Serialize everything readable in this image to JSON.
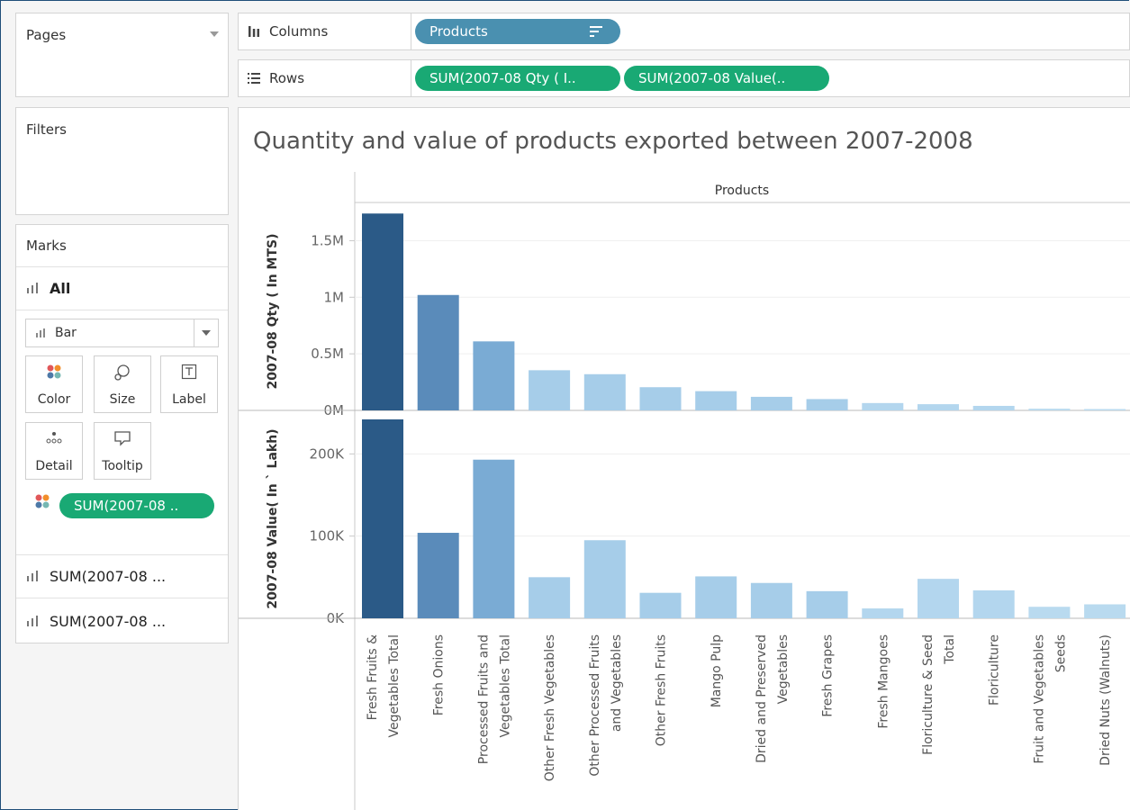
{
  "pages": {
    "title": "Pages"
  },
  "filters": {
    "title": "Filters"
  },
  "marks": {
    "title": "Marks",
    "all_label": "All",
    "mark_type": "Bar",
    "buttons": {
      "color": "Color",
      "size": "Size",
      "label": "Label",
      "detail": "Detail",
      "tooltip": "Tooltip"
    },
    "color_pill": "SUM(2007-08 ..",
    "sub_cards": [
      "SUM(2007-08 ...",
      "SUM(2007-08 ..."
    ]
  },
  "columns": {
    "label": "Columns",
    "pill": "Products"
  },
  "rows": {
    "label": "Rows",
    "pills": [
      "SUM(2007-08 Qty ( I..",
      "SUM(2007-08 Value(.."
    ]
  },
  "view": {
    "title": "Quantity and value of products exported  between 2007-2008",
    "header": "Products"
  },
  "chart_data": {
    "type": "bar",
    "categories": [
      [
        "Fresh Fruits &",
        "Vegetables Total"
      ],
      [
        "Fresh Onions"
      ],
      [
        "Processed Fruits and",
        "Vegetables Total"
      ],
      [
        "Other Fresh Vegetables"
      ],
      [
        "Other Processed Fruits",
        "and Vegetables"
      ],
      [
        "Other Fresh Fruits"
      ],
      [
        "Mango Pulp"
      ],
      [
        "Dried and Preserved",
        "Vegetables"
      ],
      [
        "Fresh Grapes"
      ],
      [
        "Fresh Mangoes"
      ],
      [
        "Floriculture & Seed",
        "Total"
      ],
      [
        "Floriculture"
      ],
      [
        "Fruit and Vegetables",
        "Seeds"
      ],
      [
        "Dried Nuts (Walnuts)"
      ]
    ],
    "panes": [
      {
        "ylabel": "2007-08 Qty ( In MTS)",
        "ylim": [
          0,
          1750000
        ],
        "ticks": [
          {
            "v": 0,
            "label": "0M"
          },
          {
            "v": 500000,
            "label": "0.5M"
          },
          {
            "v": 1000000,
            "label": "1M"
          },
          {
            "v": 1500000,
            "label": "1.5M"
          }
        ],
        "values": [
          1740000,
          1020000,
          610000,
          355000,
          320000,
          205000,
          170000,
          120000,
          100000,
          65000,
          55000,
          40000,
          15000,
          12000
        ]
      },
      {
        "ylabel": "2007-08 Value( In ` Lakh)",
        "ylim": [
          0,
          242000
        ],
        "ticks": [
          {
            "v": 0,
            "label": "0K"
          },
          {
            "v": 100000,
            "label": "100K"
          },
          {
            "v": 200000,
            "label": "200K"
          }
        ],
        "values": [
          242000,
          104000,
          193000,
          50000,
          95000,
          31000,
          51000,
          43000,
          33000,
          12000,
          48000,
          34000,
          14000,
          17000
        ]
      }
    ],
    "colors": [
      "#2b5a87",
      "#5a8bba",
      "#7aabd4",
      "#a6cde9",
      "#a6cde9",
      "#a6cde9",
      "#a6cde9",
      "#a6cde9",
      "#a6cde9",
      "#b3d6ee",
      "#b3d6ee",
      "#b3d6ee",
      "#b9daef",
      "#b9daef"
    ]
  }
}
